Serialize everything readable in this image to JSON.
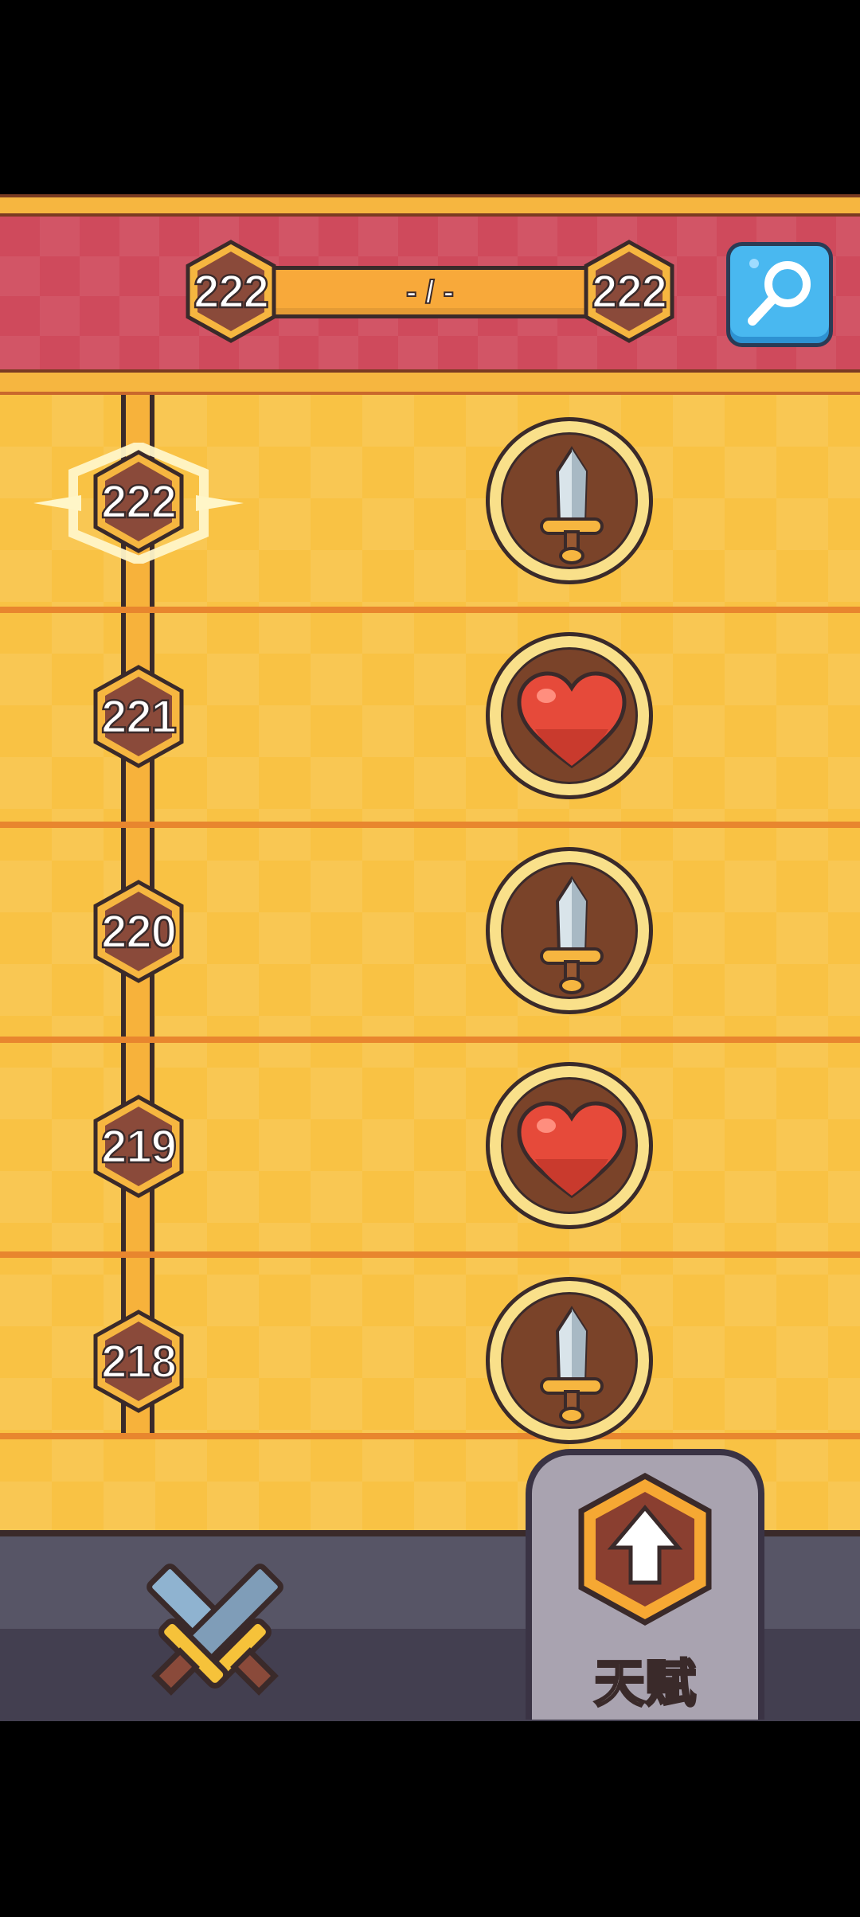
{
  "header": {
    "current_level": "222",
    "progress_text": "- / -",
    "target_level": "222",
    "search_icon": "magnifier-icon",
    "colors": {
      "banner": "#cf4a5c",
      "progress": "#f8a93a",
      "search_button": "#49b8f0"
    }
  },
  "timeline": {
    "rows": [
      {
        "level": "222",
        "reward_icon": "sword-icon",
        "selected": true
      },
      {
        "level": "221",
        "reward_icon": "heart-icon",
        "selected": false
      },
      {
        "level": "220",
        "reward_icon": "sword-icon",
        "selected": false
      },
      {
        "level": "219",
        "reward_icon": "heart-icon",
        "selected": false
      },
      {
        "level": "218",
        "reward_icon": "sword-icon",
        "selected": false
      }
    ]
  },
  "bottom_nav": {
    "battle_icon": "crossed-swords-icon",
    "talent_icon": "upgrade-arrow-hex-icon",
    "talent_label": "天赋"
  }
}
